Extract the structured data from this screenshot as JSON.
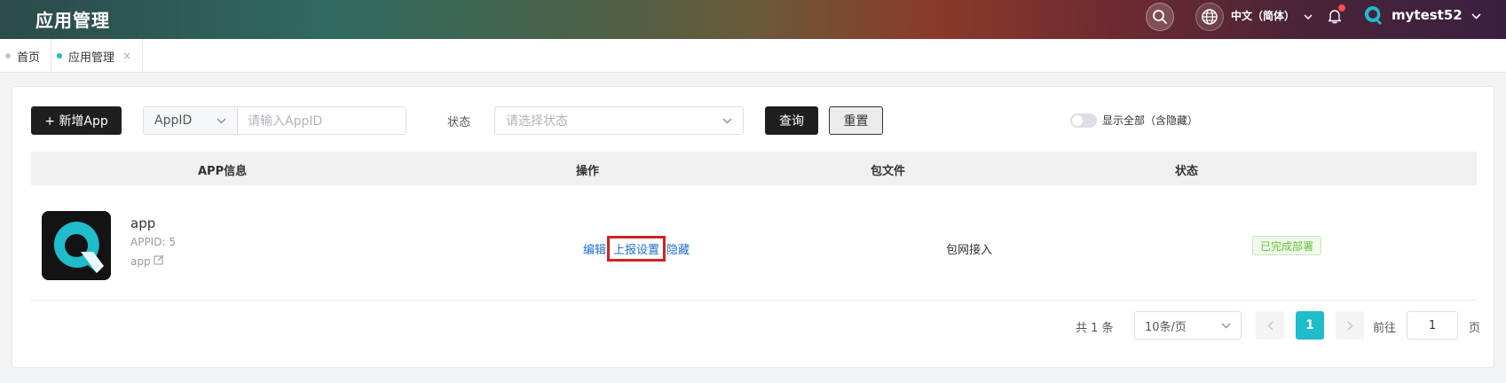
{
  "header": {
    "title": "应用管理",
    "language": "中文（简体）",
    "username": "mytest52",
    "search_icon": "search-icon",
    "globe_icon": "globe-icon",
    "bell_icon": "bell-icon"
  },
  "tabs": [
    {
      "label": "首页",
      "active": false
    },
    {
      "label": "应用管理",
      "active": true,
      "close": "×"
    }
  ],
  "toolbar": {
    "new_button": "+ 新增App",
    "filter_field": "AppID",
    "appid_placeholder": "请输入AppID",
    "status_label": "状态",
    "status_placeholder": "请选择状态",
    "query_button": "查询",
    "reset_button": "重置",
    "show_all_label": "显示全部（含隐藏）",
    "show_all_on": false
  },
  "table": {
    "columns": [
      "APP信息",
      "操作",
      "包文件",
      "状态"
    ],
    "rows": [
      {
        "name": "app",
        "appid": "APPID: 5",
        "package": "app",
        "actions": [
          "编辑",
          "上报设置",
          "隐藏"
        ],
        "package_type": "包网接入",
        "status": "已完成部署"
      }
    ]
  },
  "pagination": {
    "total": "共 1 条",
    "page_size": "10条/页",
    "current_page": "1",
    "goto_label": "前往",
    "goto_value": "1",
    "page_unit": "页"
  },
  "colors": {
    "accent": "#1fbccc",
    "link": "#1e6fd8",
    "success": "#67c23a",
    "highlight": "#d0231f"
  }
}
